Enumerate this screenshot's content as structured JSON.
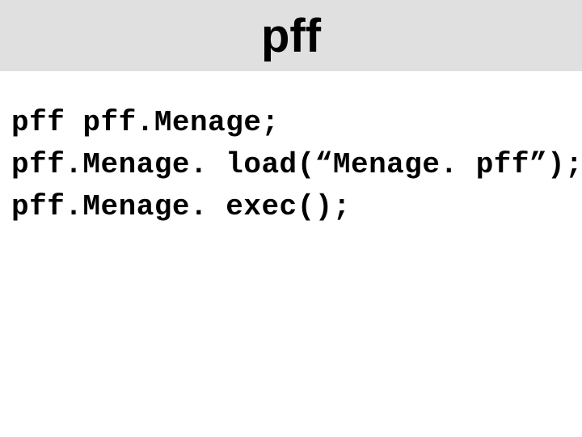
{
  "title": "pff",
  "code": {
    "line1": "pff pff.Menage;",
    "line2": "pff.Menage. load(“Menage. pff”);",
    "line3": "pff.Menage. exec();"
  }
}
